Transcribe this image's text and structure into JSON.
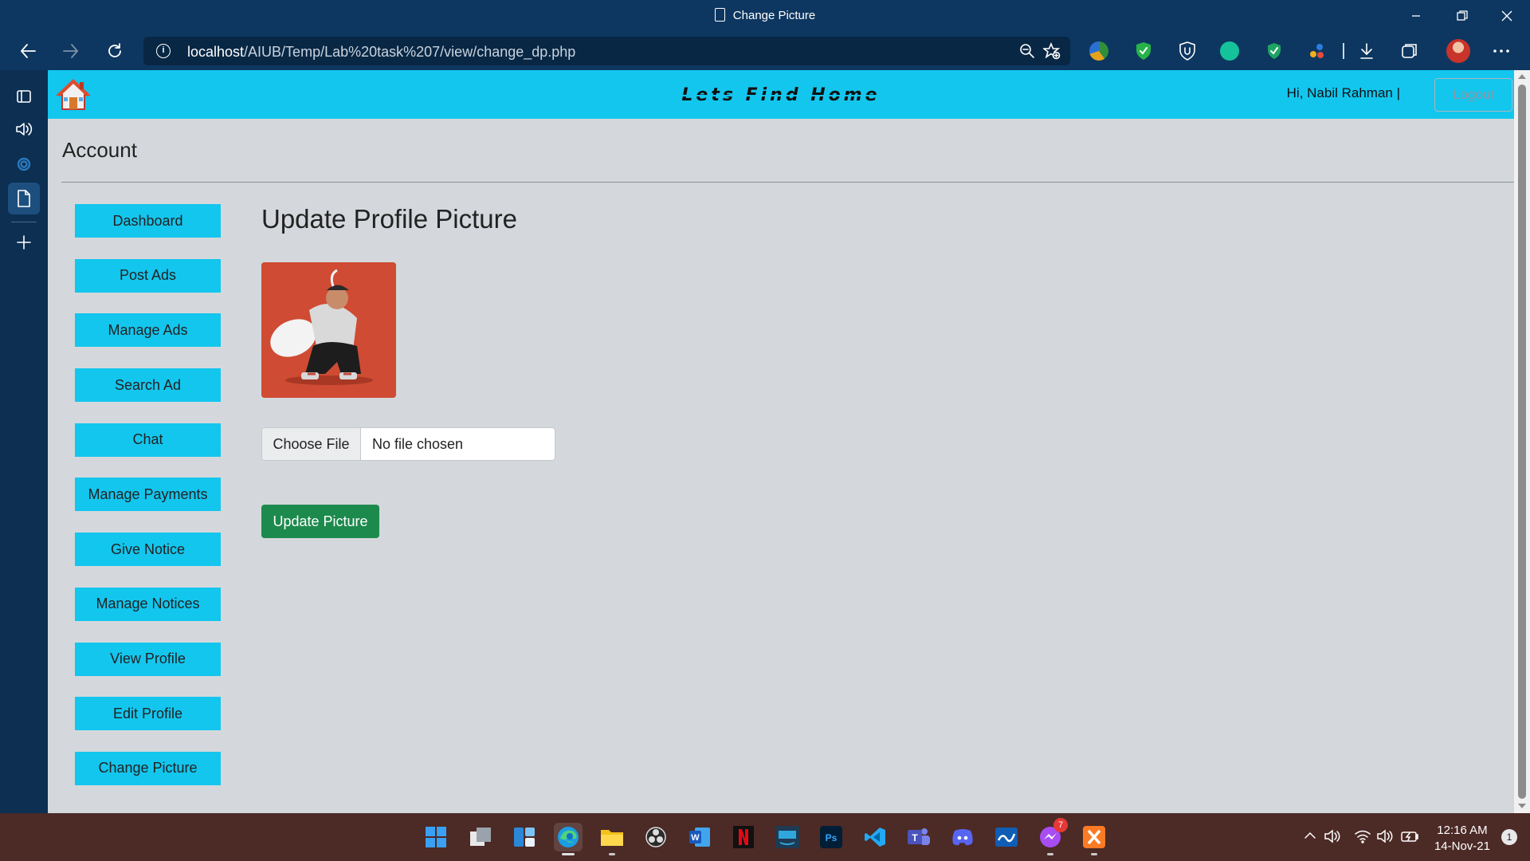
{
  "window": {
    "title": "Change Picture"
  },
  "browser": {
    "url_host": "localhost",
    "url_path": "/AIUB/Temp/Lab%20task%207/view/change_dp.php"
  },
  "site": {
    "brand": "Lets Find Home",
    "greeting": "Hi, Nabil Rahman  |",
    "logout_label": "Logout",
    "nav_color": "#13c6ee"
  },
  "account": {
    "heading": "Account"
  },
  "menu": {
    "items": [
      {
        "label": "Dashboard"
      },
      {
        "label": "Post Ads"
      },
      {
        "label": "Manage Ads"
      },
      {
        "label": "Search Ad"
      },
      {
        "label": "Chat"
      },
      {
        "label": "Manage Payments"
      },
      {
        "label": "Give Notice"
      },
      {
        "label": "Manage Notices"
      },
      {
        "label": "View Profile"
      },
      {
        "label": "Edit Profile"
      },
      {
        "label": "Change Picture"
      }
    ]
  },
  "content": {
    "title": "Update Profile Picture",
    "choose_file_label": "Choose File",
    "file_status": "No file chosen",
    "update_button": "Update Picture",
    "update_button_color": "#1d8a4d"
  },
  "taskbar": {
    "time": "12:16 AM",
    "date": "14-Nov-21",
    "messenger_badge": "7",
    "notification_count": "1"
  }
}
